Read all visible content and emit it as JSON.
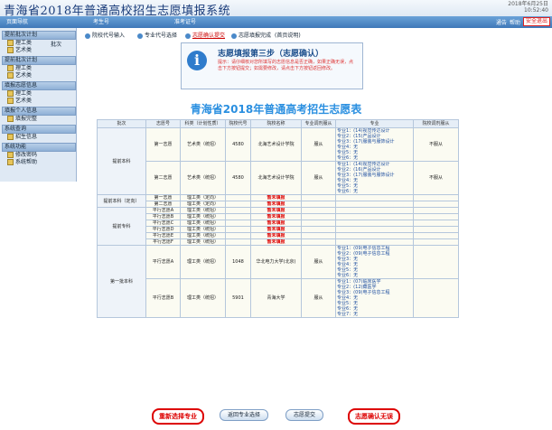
{
  "header": {
    "title": "青海省2018年普通高校招生志愿填报系统",
    "date_line1": "2018年6月25日",
    "date_line2": "10:52:40"
  },
  "nav": {
    "tabs": [
      "页面导航",
      "考生号",
      "准考证号"
    ],
    "right_items": [
      "通告",
      "帮助"
    ],
    "exit_label": "安全退出"
  },
  "sidebar": {
    "groups": [
      {
        "title": "提前批次计划",
        "items": [
          "理工类",
          "艺术类"
        ],
        "extra": "批次"
      },
      {
        "title": "提前批次计划",
        "items": [
          "理工类",
          "艺术类"
        ]
      },
      {
        "title": "填报志愿信息",
        "items": [
          "理工类",
          "艺术类"
        ]
      },
      {
        "title": "填报个人信息",
        "items": [
          "填报完整"
        ]
      },
      {
        "title": "系统查询",
        "items": [
          "招生信息"
        ]
      },
      {
        "title": "系统功能",
        "items": [
          "修改密码",
          "系统帮助"
        ]
      }
    ]
  },
  "steps": [
    "院校代号输入",
    "专业代号选择",
    "志愿确认提交",
    "志愿填报完成",
    "(首页说明)"
  ],
  "notice": {
    "icon": "info-icon",
    "title": "志愿填报第三步（志愿确认）",
    "text": "提示：请仔细核对您所填写的志愿信息是否正确，如果正确无误，点击下方按钮提交；如需要修改，请点击下方按钮返回修改。"
  },
  "table_title": "青海省2018年普通高考招生志愿表",
  "table": {
    "headers": [
      "批次",
      "志愿号",
      "科类（计划性质）",
      "院校代号",
      "院校名称",
      "专业调剂服从",
      "专业",
      "院校调剂服从"
    ],
    "sections": [
      {
        "batch": "提前本科",
        "rows": [
          {
            "vol": "第一志愿",
            "kind": "艺术类（统招）",
            "code": "4580",
            "school": "北海艺术设计学院",
            "adjust": "服从",
            "majors": [
              "专业1：(14)视觉传达设计",
              "专业2：(15)产品设计",
              "专业3：(17)服装与服饰设计",
              "专业4：无",
              "专业5：无",
              "专业6：无"
            ],
            "school_adjust": "不服从"
          },
          {
            "vol": "第二志愿",
            "kind": "艺术类（统招）",
            "code": "4580",
            "school": "北海艺术设计学院",
            "adjust": "服从",
            "majors": [
              "专业1：(14)视觉传达设计",
              "专业2：(16)产品设计",
              "专业3：(17)服装与服饰设计",
              "专业4：无",
              "专业5：无",
              "专业6：无"
            ],
            "school_adjust": "不服从"
          }
        ]
      },
      {
        "batch": "提前本科（定向）",
        "rows": [
          {
            "vol": "第一志愿",
            "kind": "理工类（定向）",
            "code": "",
            "school": "暂未填报",
            "adjust": "",
            "majors": [],
            "school_adjust": ""
          },
          {
            "vol": "第二志愿",
            "kind": "理工类（定向）",
            "code": "",
            "school": "暂未填报",
            "adjust": "",
            "majors": [],
            "school_adjust": ""
          }
        ]
      },
      {
        "batch": "提前专科",
        "rows": [
          {
            "vol": "平行志愿A",
            "kind": "理工类（统招）",
            "code": "",
            "school": "暂未填报",
            "adjust": "",
            "majors": [],
            "school_adjust": ""
          },
          {
            "vol": "平行志愿B",
            "kind": "理工类（统招）",
            "code": "",
            "school": "暂未填报",
            "adjust": "",
            "majors": [],
            "school_adjust": ""
          },
          {
            "vol": "平行志愿C",
            "kind": "理工类（统招）",
            "code": "",
            "school": "暂未填报",
            "adjust": "",
            "majors": [],
            "school_adjust": ""
          },
          {
            "vol": "平行志愿D",
            "kind": "理工类（统招）",
            "code": "",
            "school": "暂未填报",
            "adjust": "",
            "majors": [],
            "school_adjust": ""
          },
          {
            "vol": "平行志愿E",
            "kind": "理工类（统招）",
            "code": "",
            "school": "暂未填报",
            "adjust": "",
            "majors": [],
            "school_adjust": ""
          },
          {
            "vol": "平行志愿F",
            "kind": "理工类（统招）",
            "code": "",
            "school": "暂未填报",
            "adjust": "",
            "majors": [],
            "school_adjust": ""
          }
        ]
      },
      {
        "batch": "第一批本科",
        "rows": [
          {
            "vol": "平行志愿A",
            "kind": "理工类（统招）",
            "code": "1048",
            "school": "华北电力大学(北京)",
            "adjust": "服从",
            "majors": [
              "专业1：(09)电子信息工程",
              "专业2：(09)电子信息工程",
              "专业3：无",
              "专业4：无",
              "专业5：无",
              "专业6：无"
            ],
            "school_adjust": ""
          },
          {
            "vol": "平行志愿B",
            "kind": "理工类（统招）",
            "code": "5901",
            "school": "青海大学",
            "adjust": "服从",
            "majors": [
              "专业1：(07)临床医学",
              "专业2：(12)藏医学",
              "专业3：(09)电子信息工程",
              "专业4：无",
              "专业5：无",
              "专业6：无",
              "专业7：无"
            ],
            "school_adjust": ""
          }
        ]
      }
    ]
  },
  "buttons": {
    "reselect": "重新选择专业",
    "back": "返回专业选择",
    "submit": "志愿提交",
    "confirm": "志愿确认无误"
  }
}
